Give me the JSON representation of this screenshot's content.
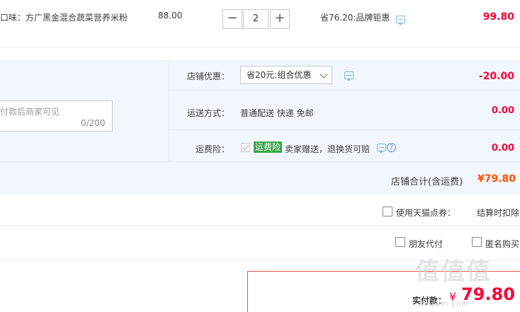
{
  "product": {
    "name": "口味：方广黑金混合蔬菜营养米粉",
    "unit_price": "88.00",
    "quantity": "2",
    "minus": "−",
    "plus": "+",
    "discount": "省76.20:品牌钜惠",
    "total": "99.80"
  },
  "message": {
    "placeholder": "付款后商家可见",
    "count": "0/200"
  },
  "shop_discount": {
    "label": "店铺优惠：",
    "selected": "省20元:组合优惠",
    "value": "-20.00"
  },
  "shipping": {
    "label": "运送方式：",
    "method": "普通配送 快递 免邮",
    "value": "0.00"
  },
  "insurance": {
    "label": "运费险：",
    "badge": "运费险",
    "text": "卖家赠送，退换货可赔",
    "help": "?",
    "value": "0.00"
  },
  "subtotal": {
    "label": "店铺合计(含运费)",
    "value": "¥79.80"
  },
  "tmall_points": {
    "label": "使用天猫点券：",
    "note": "结算时扣除"
  },
  "options": {
    "friend_pay": "朋友代付",
    "anonymous": "匿名购买"
  },
  "final": {
    "label": "实付款：",
    "currency": "¥",
    "value": "79.80"
  },
  "watermark": {
    "text": "值值值",
    "sub": "smzdm.com"
  }
}
